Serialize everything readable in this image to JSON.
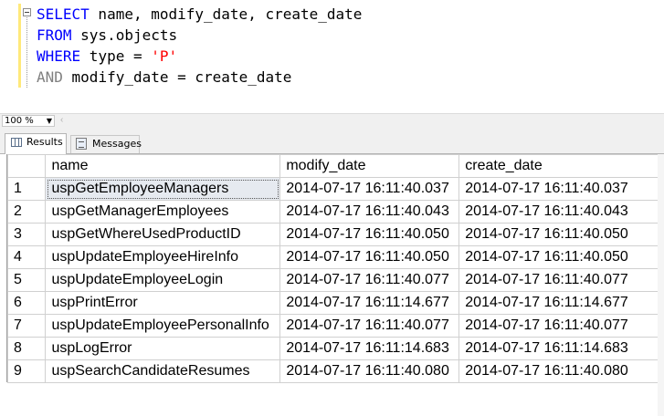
{
  "query": {
    "line1": {
      "kw": "SELECT",
      "rest": " name, modify_date, create_date"
    },
    "line2": {
      "kw": "FROM",
      "rest": " sys.objects"
    },
    "line3": {
      "kw": "WHERE",
      "mid": " type = ",
      "str": "'P'"
    },
    "line4": {
      "kw": "AND",
      "rest": " modify_date = create_date"
    }
  },
  "zoom": {
    "value": "100 %"
  },
  "tabs": {
    "results": "Results",
    "messages": "Messages"
  },
  "table": {
    "headers": [
      "name",
      "modify_date",
      "create_date"
    ],
    "rows": [
      [
        "1",
        "uspGetEmployeeManagers",
        "2014-07-17 16:11:40.037",
        "2014-07-17 16:11:40.037"
      ],
      [
        "2",
        "uspGetManagerEmployees",
        "2014-07-17 16:11:40.043",
        "2014-07-17 16:11:40.043"
      ],
      [
        "3",
        "uspGetWhereUsedProductID",
        "2014-07-17 16:11:40.050",
        "2014-07-17 16:11:40.050"
      ],
      [
        "4",
        "uspUpdateEmployeeHireInfo",
        "2014-07-17 16:11:40.050",
        "2014-07-17 16:11:40.050"
      ],
      [
        "5",
        "uspUpdateEmployeeLogin",
        "2014-07-17 16:11:40.077",
        "2014-07-17 16:11:40.077"
      ],
      [
        "6",
        "uspPrintError",
        "2014-07-17 16:11:14.677",
        "2014-07-17 16:11:14.677"
      ],
      [
        "7",
        "uspUpdateEmployeePersonalInfo",
        "2014-07-17 16:11:40.077",
        "2014-07-17 16:11:40.077"
      ],
      [
        "8",
        "uspLogError",
        "2014-07-17 16:11:14.683",
        "2014-07-17 16:11:14.683"
      ],
      [
        "9",
        "uspSearchCandidateResumes",
        "2014-07-17 16:11:40.080",
        "2014-07-17 16:11:40.080"
      ]
    ]
  },
  "colors": {
    "keyword": "#0000ff",
    "string": "#ff0000",
    "gutter": "#ffe97a",
    "selected_cell": "#e6eaf0"
  }
}
